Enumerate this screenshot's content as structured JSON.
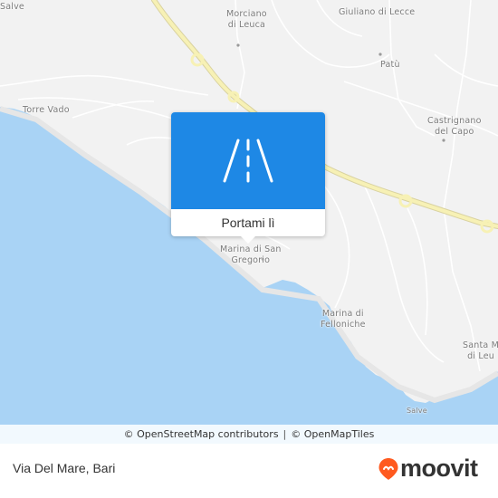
{
  "map": {
    "colors": {
      "sea": "#a9d3f5",
      "land": "#f2f2f2",
      "road_major": "#f7f1b5",
      "road_minor": "#ffffff"
    },
    "places": {
      "salve": "Salve",
      "morciano_1": "Morciano",
      "morciano_2": "di Leuca",
      "giuliano": "Giuliano di Lecce",
      "patu": "Patù",
      "torre_vado": "Torre Vado",
      "castrignano_1": "Castrignano",
      "castrignano_2": "del Capo",
      "marina_sg_1": "Marina di San",
      "marina_sg_2": "Gregorio",
      "marina_fel_1": "Marina di",
      "marina_fel_2": "Felloniche",
      "santa_m_1": "Santa M",
      "santa_m_2": "di Leu",
      "salve_bottom": "Salve"
    }
  },
  "popup": {
    "icon": "road-icon",
    "cta_label": "Portami lì",
    "color": "#1e88e5"
  },
  "attribution": {
    "osm": "© OpenStreetMap contributors",
    "sep": "|",
    "omt": "© OpenMapTiles"
  },
  "footer": {
    "title": "Via Del Mare, Bari",
    "brand": "moovit",
    "brand_color": "#ff5a1f"
  }
}
